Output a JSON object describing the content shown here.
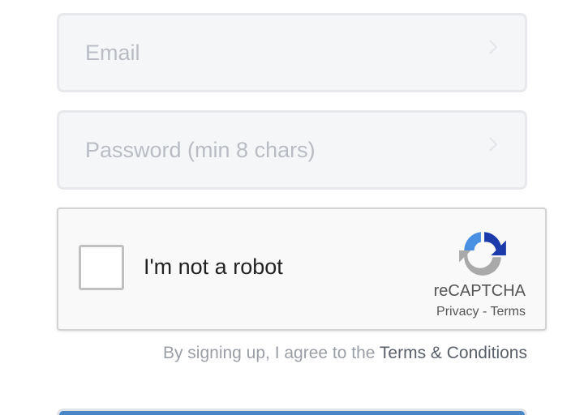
{
  "form": {
    "email": {
      "value": "",
      "placeholder": "Email"
    },
    "password": {
      "value": "",
      "placeholder": "Password (min 8 chars)"
    }
  },
  "recaptcha": {
    "checkbox_label": "I'm not a robot",
    "brand": "reCAPTCHA",
    "privacy": "Privacy",
    "separator": " - ",
    "terms": "Terms"
  },
  "agreement": {
    "prefix": "By signing up, I agree to the ",
    "link": "Terms & Conditions"
  },
  "icons": {
    "field_arrow": "chevron-right-icon",
    "recaptcha_logo": "recaptcha-logo-icon"
  },
  "colors": {
    "field_bg": "#f5f6f8",
    "placeholder": "#b9bdc3",
    "primary_button": "#4a86c5",
    "recaptcha_blue": "#4a90e2",
    "recaptcha_dark_blue": "#1c3aa9"
  }
}
